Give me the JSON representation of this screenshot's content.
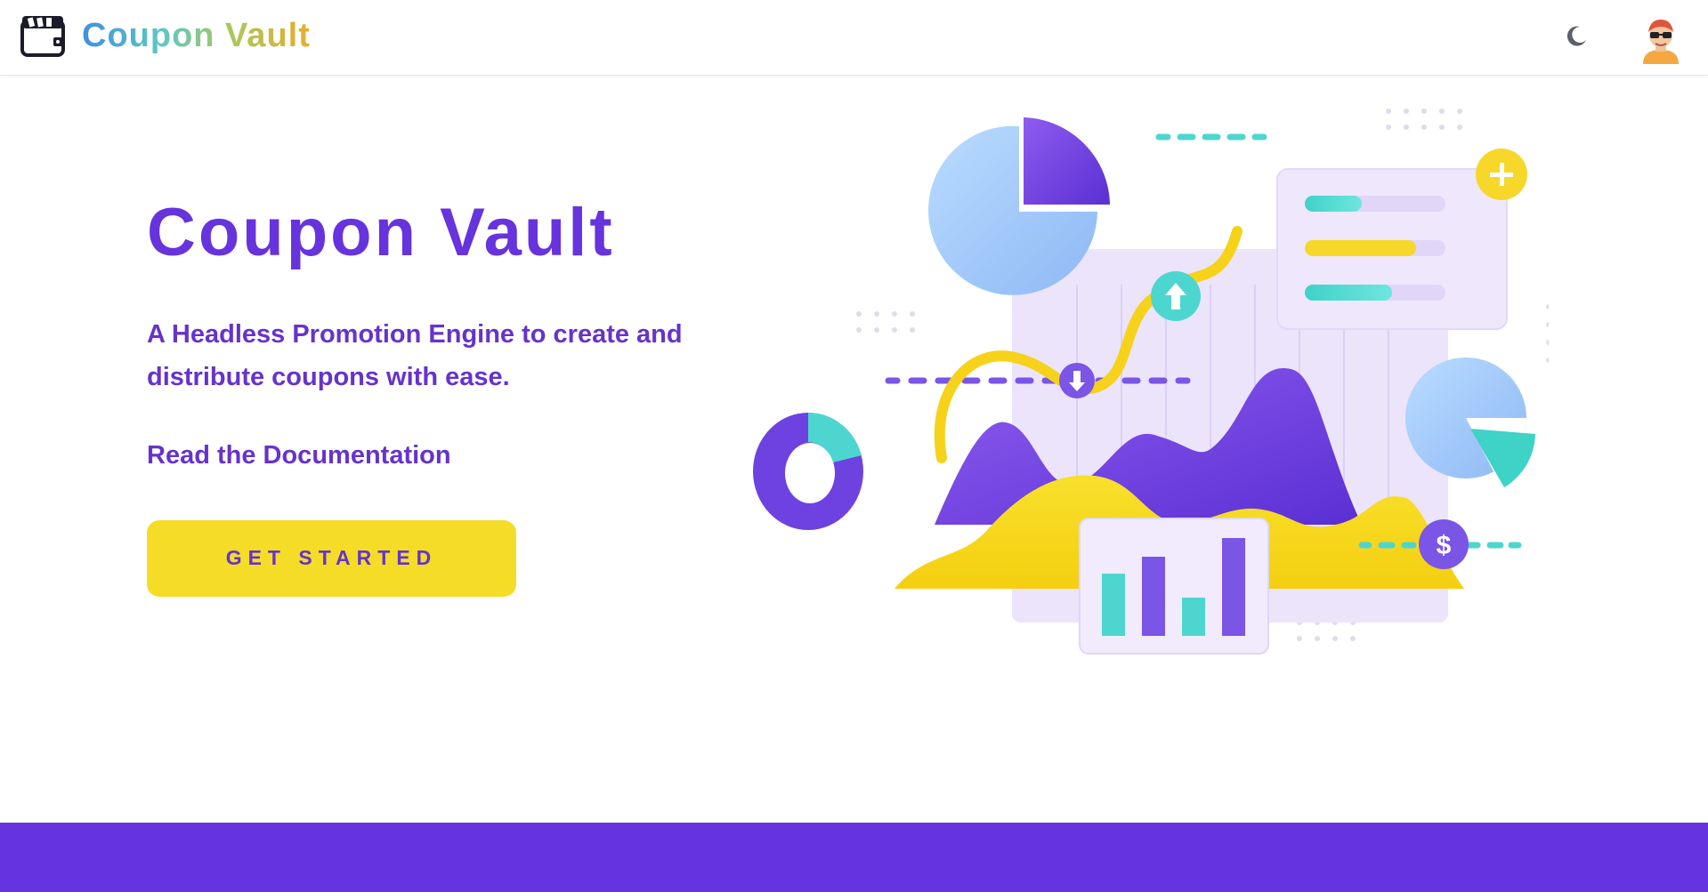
{
  "header": {
    "brand_name": "Coupon Vault",
    "logo_icon": "wallet-icon",
    "theme_icon": "moon-icon",
    "avatar_icon": "user-avatar"
  },
  "hero": {
    "title": "Coupon Vault",
    "subtitle": "A Headless Promotion Engine to create and distribute coupons with ease.",
    "docs_link": "Read the Documentation",
    "cta_label": "GET STARTED"
  },
  "colors": {
    "accent": "#6633dd",
    "cta": "#f5dc27",
    "teal": "#4dd6cf",
    "footer": "#6633e0"
  }
}
